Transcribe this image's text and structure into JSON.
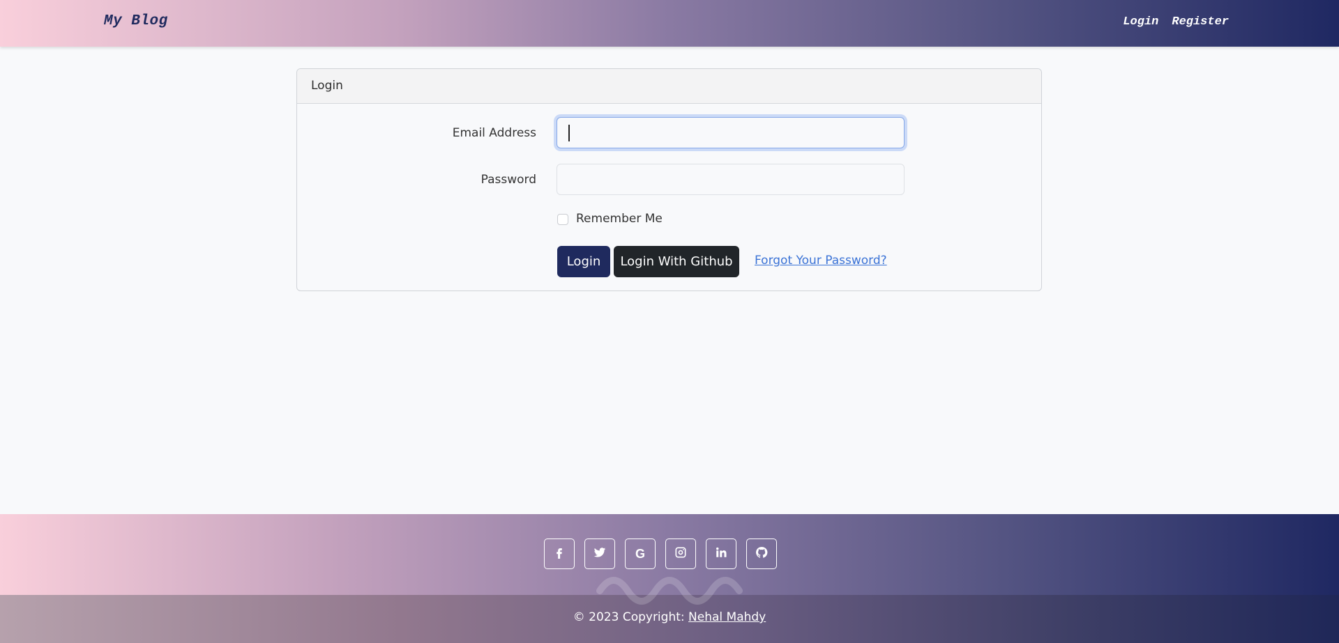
{
  "navbar": {
    "brand": "My Blog",
    "links": [
      "Login",
      "Register"
    ]
  },
  "card": {
    "header": "Login",
    "email_label": "Email Address",
    "email_value": "",
    "password_label": "Password",
    "password_value": "",
    "remember_label": "Remember Me",
    "remember_checked": false,
    "login_button": "Login",
    "github_button": "Login With Github",
    "forgot_link": "Forgot Your Password?"
  },
  "footer": {
    "social_icons": [
      "facebook-icon",
      "twitter-icon",
      "google-icon",
      "instagram-icon",
      "linkedin-icon",
      "github-icon"
    ],
    "copyright_prefix": "© 2023 Copyright: ",
    "copyright_name": "Nehal Mahdy"
  },
  "colors": {
    "primary": "#1f2a5e",
    "dark": "#212529",
    "link": "#3b73d6"
  }
}
